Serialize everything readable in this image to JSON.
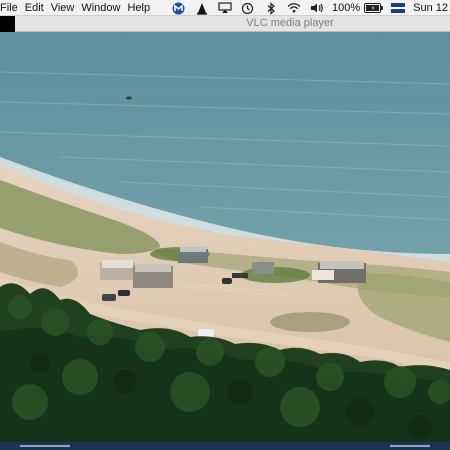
{
  "menubar": {
    "items": [
      "File",
      "Edit",
      "View",
      "Window",
      "Help"
    ],
    "battery_percent": "100%",
    "clock": "Sun 12",
    "tray_icons": [
      "malwarebytes-icon",
      "vlc-cone-icon",
      "airplay-icon",
      "time-machine-icon",
      "bluetooth-icon",
      "wifi-icon",
      "volume-icon",
      "battery-icon",
      "flag-icon"
    ]
  },
  "window": {
    "title": "VLC media player"
  },
  "video": {
    "scene": "aerial-beach-camp"
  },
  "colors": {
    "sea": "#6d9aa3",
    "sand": "#d9c3aa",
    "forest": "#1f3f22",
    "menubar_bg": "#f2f2f2",
    "titlebar_bg": "#e4e4e4"
  }
}
